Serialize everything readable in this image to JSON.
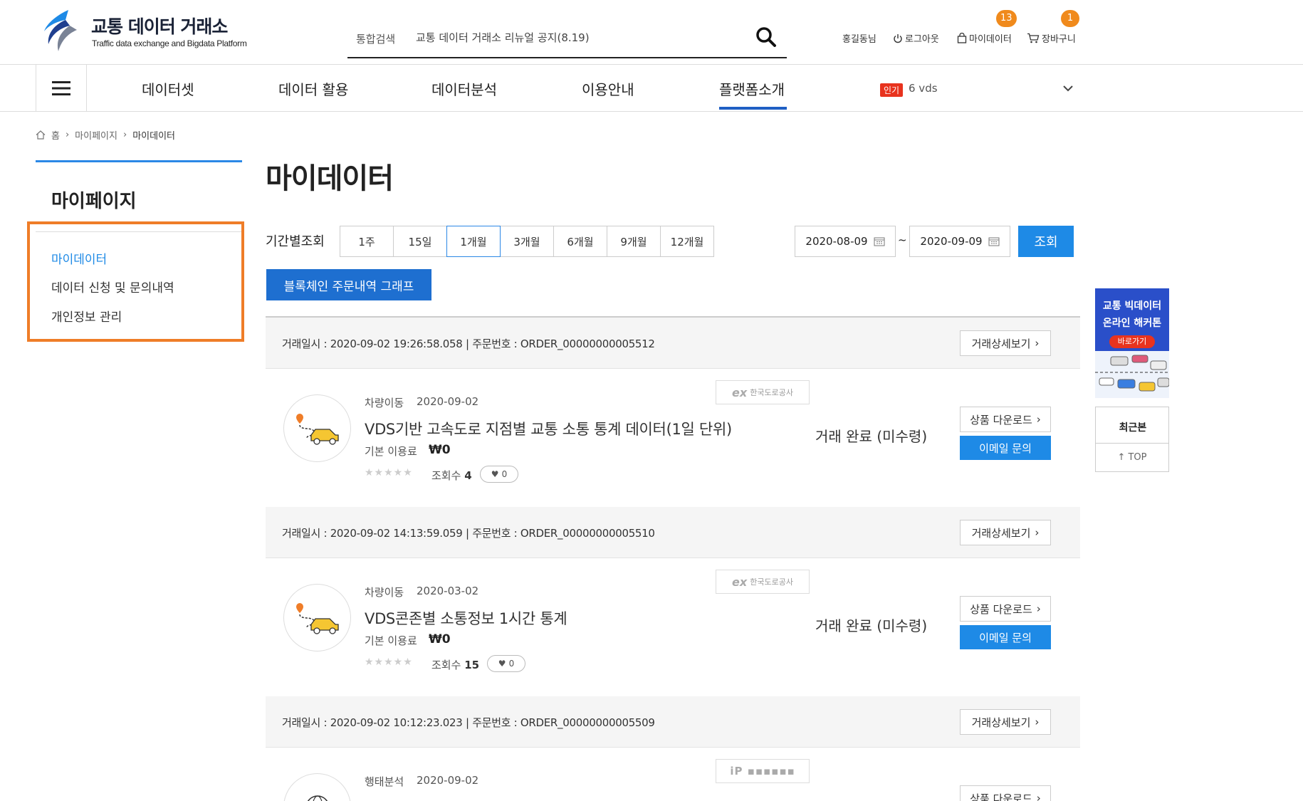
{
  "header": {
    "logo_title": "교통 데이터 거래소",
    "logo_subtitle": "Traffic data exchange and Bigdata Platform",
    "search": {
      "category": "통합검색",
      "value": "교통 데이터 거래소 리뉴얼 공지(8.19)"
    },
    "util": {
      "user": "홍길동님",
      "logout": "로그아웃",
      "mydata": "마이데이터",
      "mydata_count": "13",
      "cart": "장바구니",
      "cart_count": "1"
    }
  },
  "nav": {
    "items": [
      "데이터셋",
      "데이터 활용",
      "데이터분석",
      "이용안내",
      "플랫폼소개"
    ],
    "active": "플랫폼소개",
    "hot_badge": "인기",
    "hot_text": "6 vds"
  },
  "breadcrumb": [
    "홈",
    "마이페이지",
    "마이데이터"
  ],
  "sidebar": {
    "title": "마이페이지",
    "items": [
      {
        "label": "마이데이터",
        "active": true
      },
      {
        "label": "데이터 신청 및 문의내역",
        "active": false
      },
      {
        "label": "개인정보 관리",
        "active": false
      }
    ],
    "highlight_color": "#ef7d28"
  },
  "main": {
    "title": "마이데이터",
    "period_label": "기간별조회",
    "periods": [
      "1주",
      "15일",
      "1개월",
      "3개월",
      "6개월",
      "9개월",
      "12개월"
    ],
    "active_period": "1개월",
    "date_from": "2020-08-09",
    "date_to": "2020-09-09",
    "date_sep": "~",
    "search_btn": "조회",
    "chain_btn": "블록체인 주문내역 그래프"
  },
  "orders": [
    {
      "info": "거래일시 : 2020-09-02 19:26:58.058 | 주문번호 : ORDER_00000000005512",
      "detail_btn": "거래상세보기",
      "category": "차량이동",
      "date": "2020-09-02",
      "title": "VDS기반 고속도로 지점별 교통 소통 통계 데이터(1일 단위)",
      "fee_label": "기본 이용료",
      "fee": "₩0",
      "views_label": "조회수",
      "views": "4",
      "likes": "0",
      "provider": "한국도로공사",
      "status": "거래 완료 (미수령)",
      "download_btn": "상품 다운로드",
      "email_btn": "이메일 문의",
      "icon": "car-route-icon"
    },
    {
      "info": "거래일시 : 2020-09-02 14:13:59.059 | 주문번호 : ORDER_00000000005510",
      "detail_btn": "거래상세보기",
      "category": "차량이동",
      "date": "2020-03-02",
      "title": "VDS콘존별 소통정보 1시간 통계",
      "fee_label": "기본 이용료",
      "fee": "₩0",
      "views_label": "조회수",
      "views": "15",
      "likes": "0",
      "provider": "한국도로공사",
      "status": "거래 완료 (미수령)",
      "download_btn": "상품 다운로드",
      "email_btn": "이메일 문의",
      "icon": "car-route-icon"
    },
    {
      "info": "거래일시 : 2020-09-02 10:12:23.023 | 주문번호 : ORDER_00000000005509",
      "detail_btn": "거래상세보기",
      "category": "행태분석",
      "date": "2020-09-02",
      "download_btn": "상품 다운로드",
      "icon": "globe-icon"
    }
  ],
  "right_rail": {
    "banner_line1": "교통 빅데이터",
    "banner_line2": "온라인 해커톤",
    "banner_go": "바로가기",
    "recent": "최근본",
    "top": "TOP"
  },
  "colors": {
    "primary": "#1e8ae6",
    "nav_active": "#1f5fc4",
    "accent_orange": "#f08a1c"
  }
}
